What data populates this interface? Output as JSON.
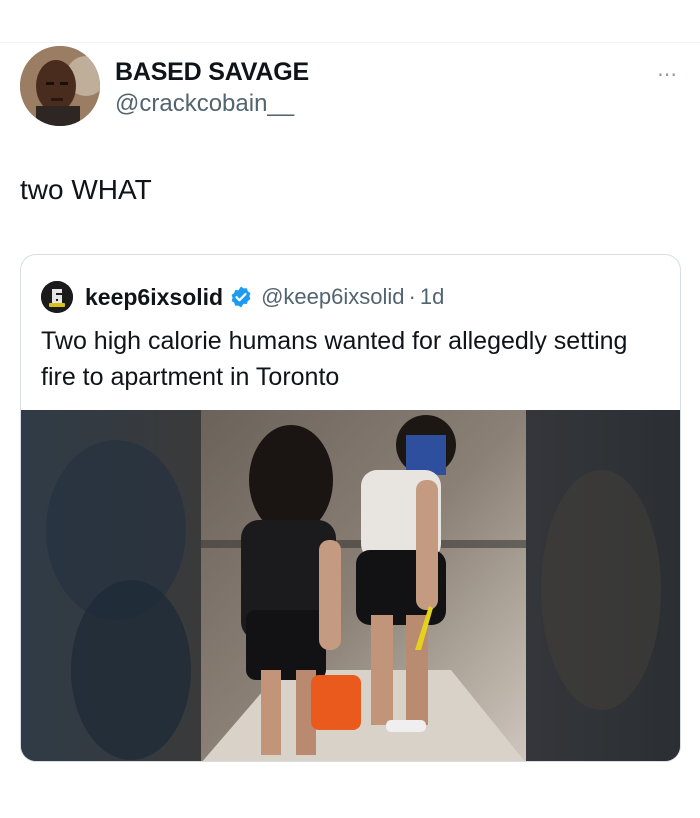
{
  "tweet": {
    "author_name": "BASED SAVAGE",
    "author_handle": "@crackcobain__",
    "text": "two WHAT",
    "more_icon": "⋯"
  },
  "quoted_tweet": {
    "author_name": "keep6ixsolid",
    "author_handle": "@keep6ixsolid",
    "separator": "·",
    "time": "1d",
    "text": "Two high calorie humans wanted for allegedly setting fire to apartment in Toronto",
    "verified_color": "#1d9bf0"
  },
  "icons": {
    "avatar": "avatar-photo",
    "logo": "keep6ixsolid-logo",
    "verified": "verified-badge-icon",
    "more": "more-options-icon"
  }
}
